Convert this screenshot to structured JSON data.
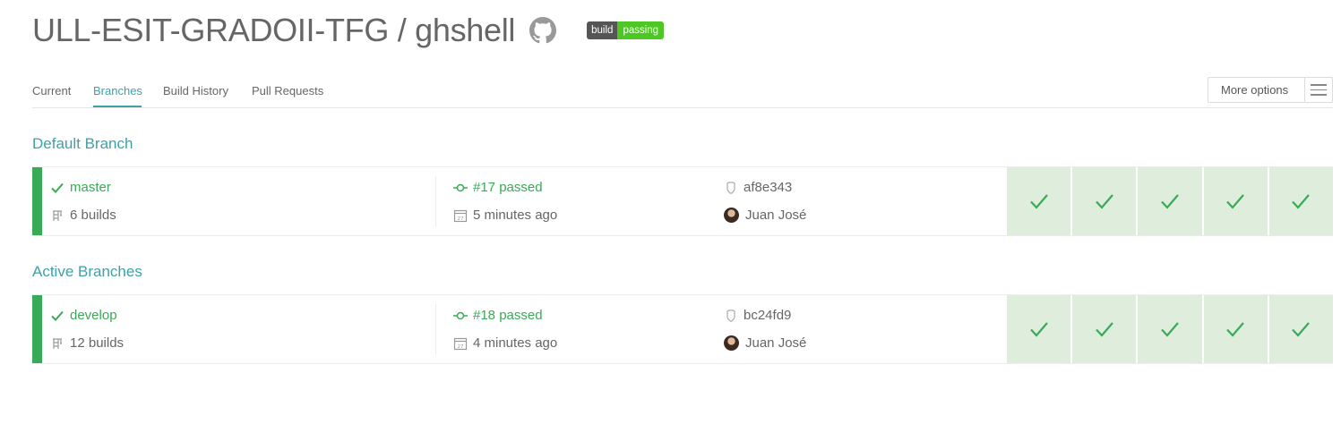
{
  "header": {
    "repo_title": "ULL-ESIT-GRADOII-TFG / ghshell",
    "badge_left": "build",
    "badge_right": "passing",
    "badge_color": "#4dc721"
  },
  "tabs": {
    "items": [
      {
        "label": "Current"
      },
      {
        "label": "Branches",
        "active": true
      },
      {
        "label": "Build History"
      },
      {
        "label": "Pull Requests"
      }
    ],
    "more_options": "More options"
  },
  "sections": {
    "default_title": "Default Branch",
    "active_title": "Active Branches"
  },
  "colors": {
    "accent": "#3ea0a8",
    "passed": "#39aa56",
    "matrix_bg": "#deeddc"
  },
  "branches": [
    {
      "name": "master",
      "builds": "6 builds",
      "build_status": "#17 passed",
      "time": "5 minutes ago",
      "commit": "af8e343",
      "author": "Juan José",
      "matrix": [
        "passed",
        "passed",
        "passed",
        "passed",
        "passed"
      ]
    },
    {
      "name": "develop",
      "builds": "12 builds",
      "build_status": "#18 passed",
      "time": "4 minutes ago",
      "commit": "bc24fd9",
      "author": "Juan José",
      "matrix": [
        "passed",
        "passed",
        "passed",
        "passed",
        "passed"
      ]
    }
  ]
}
